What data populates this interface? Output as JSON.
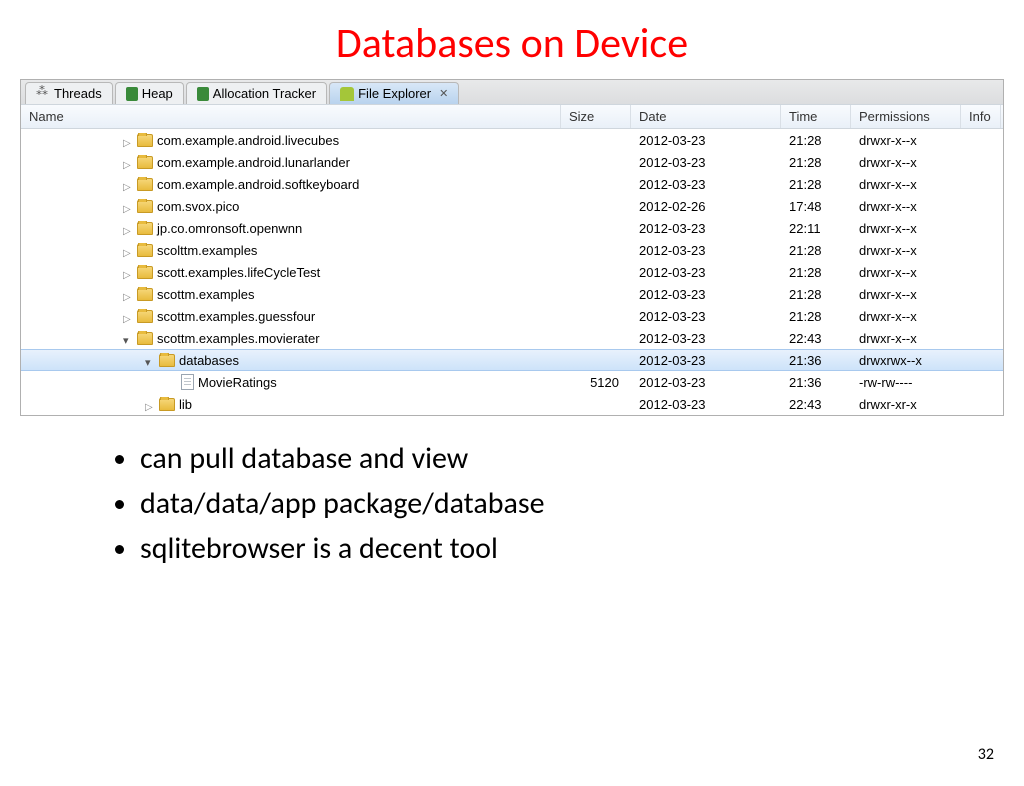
{
  "title": "Databases on Device",
  "tabs": [
    {
      "label": "Threads",
      "icon": "thread-icon",
      "active": false
    },
    {
      "label": "Heap",
      "icon": "trash-icon",
      "active": false
    },
    {
      "label": "Allocation Tracker",
      "icon": "trash-icon",
      "active": false
    },
    {
      "label": "File Explorer",
      "icon": "android-icon",
      "active": true
    }
  ],
  "columns": [
    "Name",
    "Size",
    "Date",
    "Time",
    "Permissions",
    "Info"
  ],
  "rows": [
    {
      "indent": 1,
      "expand": "collapsed",
      "icon": "folder",
      "name": "com.example.android.livecubes",
      "size": "",
      "date": "2012-03-23",
      "time": "21:28",
      "perm": "drwxr-x--x"
    },
    {
      "indent": 1,
      "expand": "collapsed",
      "icon": "folder",
      "name": "com.example.android.lunarlander",
      "size": "",
      "date": "2012-03-23",
      "time": "21:28",
      "perm": "drwxr-x--x"
    },
    {
      "indent": 1,
      "expand": "collapsed",
      "icon": "folder",
      "name": "com.example.android.softkeyboard",
      "size": "",
      "date": "2012-03-23",
      "time": "21:28",
      "perm": "drwxr-x--x"
    },
    {
      "indent": 1,
      "expand": "collapsed",
      "icon": "folder",
      "name": "com.svox.pico",
      "size": "",
      "date": "2012-02-26",
      "time": "17:48",
      "perm": "drwxr-x--x"
    },
    {
      "indent": 1,
      "expand": "collapsed",
      "icon": "folder",
      "name": "jp.co.omronsoft.openwnn",
      "size": "",
      "date": "2012-03-23",
      "time": "22:11",
      "perm": "drwxr-x--x"
    },
    {
      "indent": 1,
      "expand": "collapsed",
      "icon": "folder",
      "name": "scolttm.examples",
      "size": "",
      "date": "2012-03-23",
      "time": "21:28",
      "perm": "drwxr-x--x"
    },
    {
      "indent": 1,
      "expand": "collapsed",
      "icon": "folder",
      "name": "scott.examples.lifeCycleTest",
      "size": "",
      "date": "2012-03-23",
      "time": "21:28",
      "perm": "drwxr-x--x"
    },
    {
      "indent": 1,
      "expand": "collapsed",
      "icon": "folder",
      "name": "scottm.examples",
      "size": "",
      "date": "2012-03-23",
      "time": "21:28",
      "perm": "drwxr-x--x"
    },
    {
      "indent": 1,
      "expand": "collapsed",
      "icon": "folder",
      "name": "scottm.examples.guessfour",
      "size": "",
      "date": "2012-03-23",
      "time": "21:28",
      "perm": "drwxr-x--x"
    },
    {
      "indent": 1,
      "expand": "expanded",
      "icon": "folder",
      "name": "scottm.examples.movierater",
      "size": "",
      "date": "2012-03-23",
      "time": "22:43",
      "perm": "drwxr-x--x"
    },
    {
      "indent": 2,
      "expand": "expanded",
      "icon": "folder",
      "name": "databases",
      "size": "",
      "date": "2012-03-23",
      "time": "21:36",
      "perm": "drwxrwx--x",
      "selected": true
    },
    {
      "indent": 3,
      "expand": "none",
      "icon": "file",
      "name": "MovieRatings",
      "size": "5120",
      "date": "2012-03-23",
      "time": "21:36",
      "perm": "-rw-rw----"
    },
    {
      "indent": 2,
      "expand": "collapsed",
      "icon": "folder",
      "name": "lib",
      "size": "",
      "date": "2012-03-23",
      "time": "22:43",
      "perm": "drwxr-xr-x"
    }
  ],
  "bullets": [
    "can pull database and view",
    "data/data/app package/database",
    "sqlitebrowser is a decent tool"
  ],
  "page_number": "32"
}
